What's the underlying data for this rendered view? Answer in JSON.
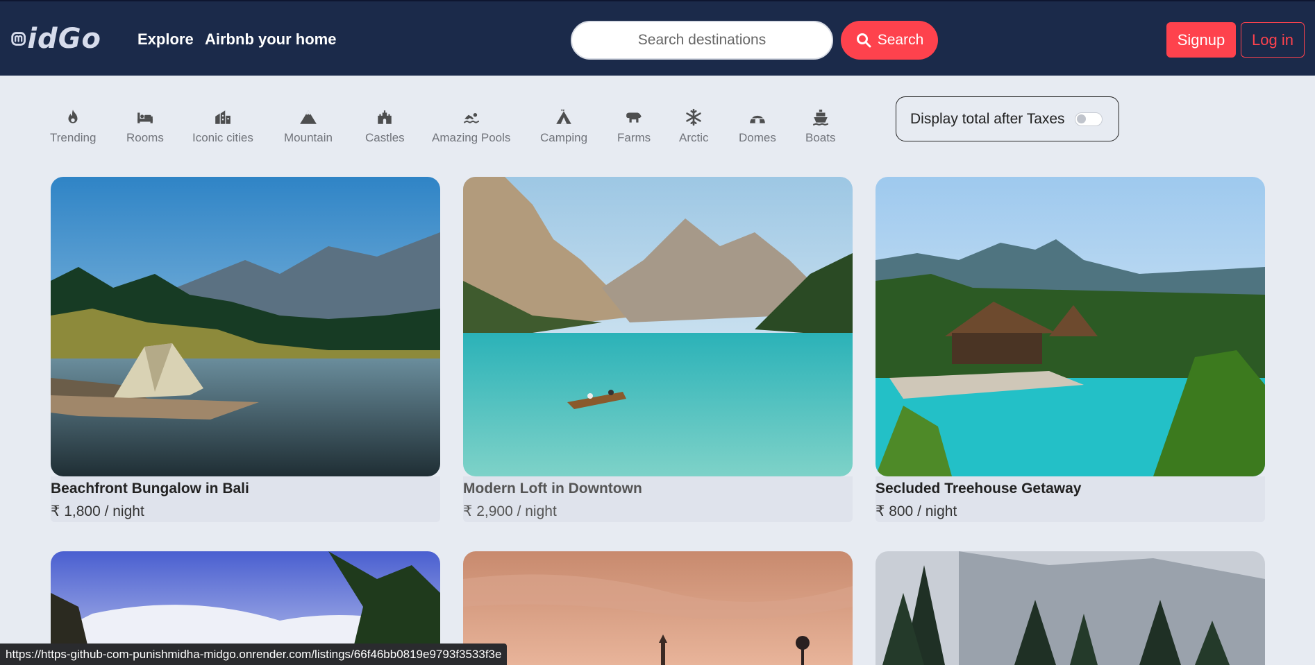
{
  "header": {
    "logo_text": "idGo",
    "nav": {
      "explore": "Explore",
      "host": "Airbnb your home"
    },
    "search": {
      "placeholder": "Search destinations",
      "button_label": "Search"
    },
    "auth": {
      "signup": "Signup",
      "login": "Log in"
    },
    "colors": {
      "navbar_bg": "#1b2a4a",
      "accent": "#fe424d"
    }
  },
  "filters": [
    {
      "label": "Trending",
      "icon": "fire-icon"
    },
    {
      "label": "Rooms",
      "icon": "bed-icon"
    },
    {
      "label": "Iconic cities",
      "icon": "city-icon"
    },
    {
      "label": "Mountain",
      "icon": "mountain-icon"
    },
    {
      "label": "Castles",
      "icon": "castle-icon"
    },
    {
      "label": "Amazing Pools",
      "icon": "swimmer-icon"
    },
    {
      "label": "Camping",
      "icon": "tent-icon"
    },
    {
      "label": "Farms",
      "icon": "cow-icon"
    },
    {
      "label": "Arctic",
      "icon": "snowflake-icon"
    },
    {
      "label": "Domes",
      "icon": "igloo-icon"
    },
    {
      "label": "Boats",
      "icon": "ship-icon"
    }
  ],
  "tax_toggle": {
    "label": "Display total after Taxes",
    "enabled": false
  },
  "listings": [
    {
      "title": "Beachfront Bungalow in Bali",
      "price": "₹ 1,800 / night"
    },
    {
      "title": "Modern Loft in Downtown",
      "price": "₹ 2,900 / night"
    },
    {
      "title": "Secluded Treehouse Getaway",
      "price": "₹ 800 / night"
    }
  ],
  "status_bar": {
    "url": "https://https-github-com-punishmidha-midgo.onrender.com/listings/66f46bb0819e9793f3533f3e"
  }
}
